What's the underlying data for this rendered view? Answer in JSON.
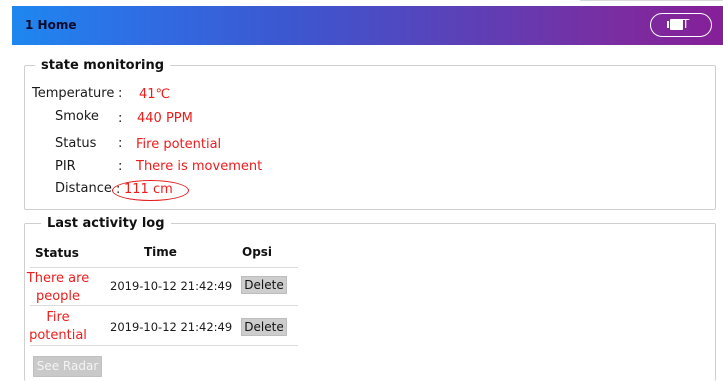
{
  "navbar": {
    "title": "1 Home",
    "exit_label": "T",
    "exit_icon": "exit-door-icon",
    "gradient_colors": [
      "#1e87f0",
      "#5e3fb6",
      "#861f98"
    ]
  },
  "state_monitoring": {
    "legend": "state monitoring",
    "temperature": {
      "label": "Temperature",
      "separator": ":",
      "value": "41℃"
    },
    "smoke": {
      "label": "Smoke",
      "separator": ":",
      "value": "440 PPM"
    },
    "status": {
      "label": "Status",
      "separator": ":",
      "value": "Fire potential"
    },
    "pir": {
      "label": "PIR",
      "separator": ":",
      "value": "There is movement"
    },
    "distance": {
      "label": "Distance",
      "separator": ":",
      "value": "111 cm"
    },
    "value_color": "#ef1c1c"
  },
  "activity_log": {
    "legend": "Last activity log",
    "columns": [
      "Status",
      "Time",
      "Opsi"
    ],
    "rows": [
      {
        "status_line1": "There are",
        "status_line2": "people",
        "time": "2019-10-12 21:42:49",
        "action": "Delete"
      },
      {
        "status_line1": "Fire",
        "status_line2": "potential",
        "time": "2019-10-12 21:42:49",
        "action": "Delete"
      }
    ],
    "see_radar_label": "See Radar"
  }
}
